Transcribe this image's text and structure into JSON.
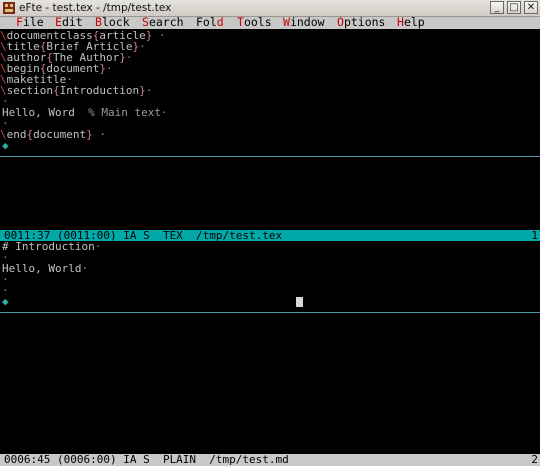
{
  "window": {
    "title": "eFte - test.tex - /tmp/test.tex",
    "minimize": "_",
    "maximize": "□",
    "close": "✕"
  },
  "menu": [
    {
      "pre": "",
      "hot": "F",
      "post": "ile"
    },
    {
      "pre": "",
      "hot": "E",
      "post": "dit"
    },
    {
      "pre": "",
      "hot": "B",
      "post": "lock"
    },
    {
      "pre": "",
      "hot": "S",
      "post": "earch"
    },
    {
      "pre": "Fol",
      "hot": "d",
      "post": ""
    },
    {
      "pre": "",
      "hot": "T",
      "post": "ools"
    },
    {
      "pre": "",
      "hot": "W",
      "post": "indow"
    },
    {
      "pre": "",
      "hot": "O",
      "post": "ptions"
    },
    {
      "pre": "",
      "hot": "H",
      "post": "elp"
    }
  ],
  "editor1": {
    "lines": {
      "documentclass": "documentclass",
      "documentclass_arg": "article",
      "title": "title",
      "title_arg": "Brief Article",
      "author": "author",
      "author_arg": "The Author",
      "begin": "begin",
      "begin_arg": "document",
      "maketitle": "maketitle",
      "section": "section",
      "section_arg": "Introduction",
      "hello": "Hello, Word  ",
      "comment": "% Main text",
      "end": "end",
      "end_arg": "document"
    },
    "status": "0011:37 (0011:00) IA S  TEX  /tmp/test.tex",
    "status_right": "1"
  },
  "editor2": {
    "lines": {
      "heading": "# Introduction",
      "hello": "Hello, World"
    },
    "status": "0006:45 (0006:00) IA S  PLAIN  /tmp/test.md",
    "status_right": "2"
  },
  "colors": {
    "status_active": "#00a8a8",
    "status_inactive": "#c8c8c8",
    "hotkey": "#cc0000",
    "latex_command": "#cc4444"
  }
}
